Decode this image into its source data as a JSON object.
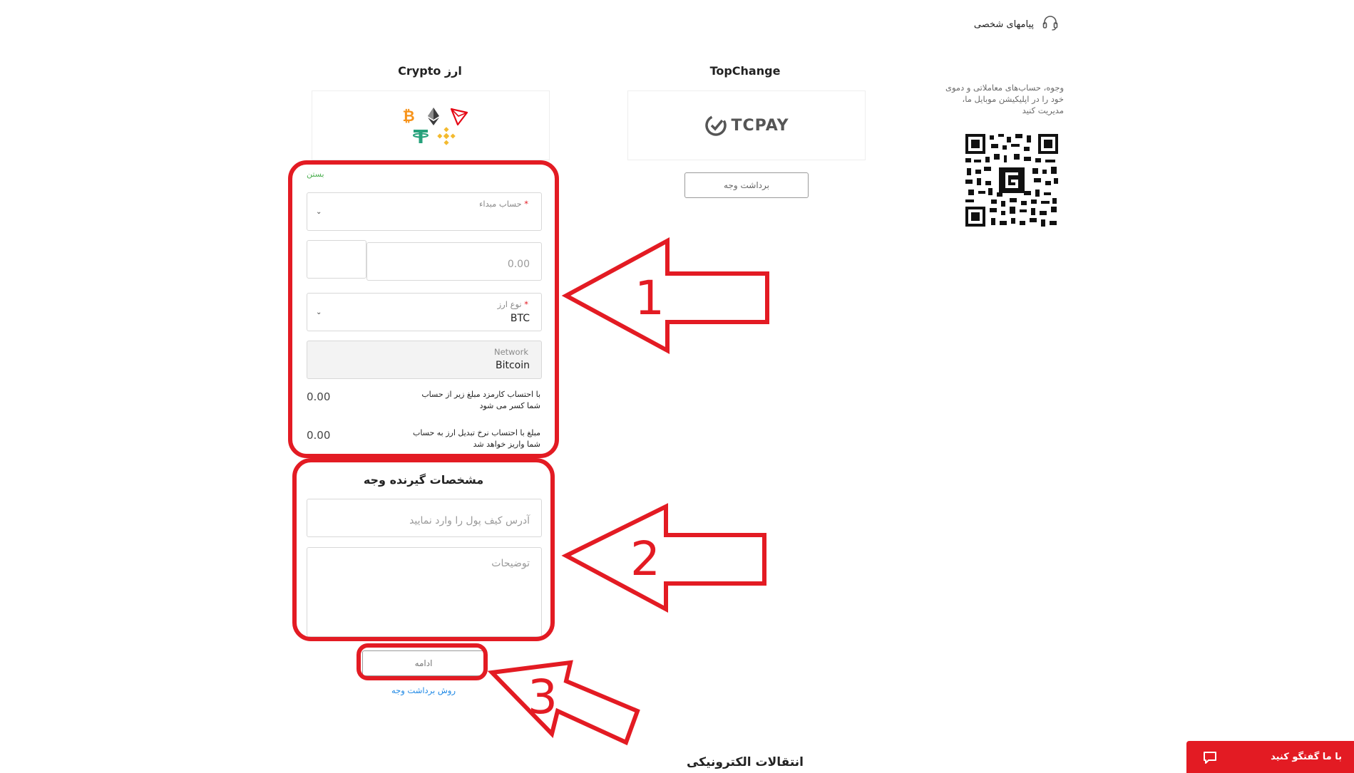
{
  "header": {
    "messages_label": "پیامهای شخصی",
    "icon": "headset-icon"
  },
  "promo": {
    "text": "وجوه، حساب‌های معاملاتی و دموی خود را در اپلیکیشن موبایل ما، مدیریت کنید"
  },
  "topchange": {
    "title": "TopChange",
    "logo_text": "TCPAY",
    "withdraw_label": "برداشت وجه"
  },
  "crypto": {
    "title": "ارز Crypto",
    "coins": [
      "bitcoin-icon",
      "ethereum-icon",
      "tron-icon",
      "tether-icon",
      "bnb-icon"
    ],
    "close_label": "بستن",
    "source_account": {
      "label": "حساب مبداء",
      "required_mark": "*",
      "value": ""
    },
    "amount": {
      "placeholder": "0.00",
      "currency_box": ""
    },
    "currency_type": {
      "label": "نوع ارز",
      "required_mark": "*",
      "value": "BTC"
    },
    "network": {
      "label": "Network",
      "value": "Bitcoin"
    },
    "fee_note": {
      "line1": "با احتساب کارمزد مبلغ زیر از حساب",
      "line2": "شما کسر می شود",
      "amount": "0.00"
    },
    "rate_note": {
      "line1": "مبلغ با احتساب نرخ تبدیل ارز به حساب",
      "line2": "شما واریز خواهد شد",
      "amount": "0.00"
    }
  },
  "recipient": {
    "title": "مشخصات گیرنده وجه",
    "wallet_placeholder": "آدرس کیف پول را وارد نمایید",
    "description_placeholder": "توضیحات"
  },
  "actions": {
    "continue_label": "ادامه",
    "method_link": "روش برداشت وجه"
  },
  "footer": {
    "section_title": "انتقالات الکترونیکی"
  },
  "chat": {
    "label": "با ما گفتگو کنید",
    "icon": "chat-icon"
  },
  "annotations": {
    "arrow1": "1",
    "arrow2": "2",
    "arrow3": "3"
  },
  "colors": {
    "accent_red": "#e31b23",
    "close_green": "#4caf50",
    "link_blue": "#1e88e5"
  }
}
